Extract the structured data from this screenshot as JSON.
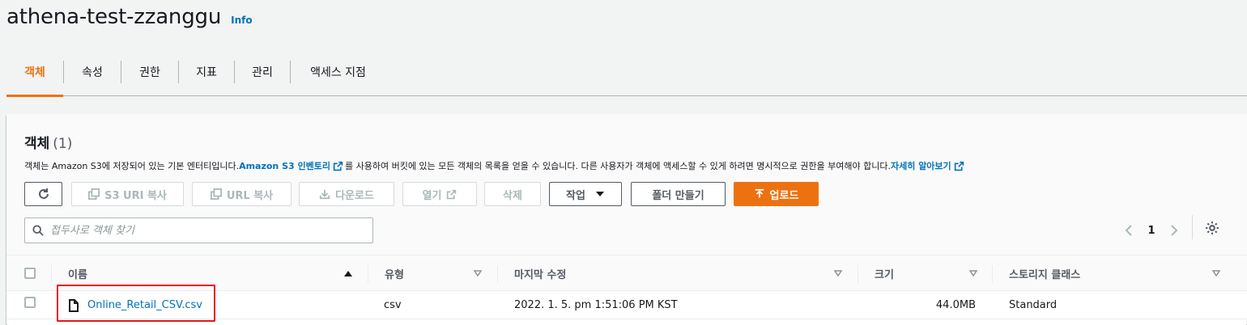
{
  "bucket": {
    "title": "athena-test-zzanggu",
    "info_label": "Info"
  },
  "tabs": [
    {
      "label": "객체",
      "active": true
    },
    {
      "label": "속성"
    },
    {
      "label": "권한"
    },
    {
      "label": "지표"
    },
    {
      "label": "관리"
    },
    {
      "label": "액세스 지점"
    }
  ],
  "objects": {
    "heading": "객체",
    "count": "(1)",
    "description": {
      "part1": "객체는 Amazon S3에 저장되어 있는 기본 엔터티입니다. ",
      "link1": "Amazon S3 인벤토리",
      "part2": "를 사용하여 버킷에 있는 모든 객체의 목록을 얻을 수 있습니다. 다른 사용자가 객체에 액세스할 수 있게 하려면 명시적으로 권한을 부여해야 합니다. ",
      "link2": "자세히 알아보기"
    },
    "toolbar": {
      "copy_s3_uri": "S3 URI 복사",
      "copy_url": "URL 복사",
      "download": "다운로드",
      "open": "열기",
      "delete": "삭제",
      "actions": "작업",
      "create_folder": "폴더 만들기",
      "upload": "업로드"
    },
    "search": {
      "placeholder": "접두사로 객체 찾기",
      "value": ""
    },
    "pagination": {
      "current_page": "1"
    },
    "table": {
      "columns": [
        "이름",
        "유형",
        "마지막 수정",
        "크기",
        "스토리지 클래스"
      ],
      "rows": [
        {
          "name": "Online_Retail_CSV.csv",
          "type": "csv",
          "last_modified": "2022. 1. 5. pm 1:51:06 PM KST",
          "size": "44.0MB",
          "storage_class": "Standard"
        }
      ]
    }
  },
  "colors": {
    "accent": "#ec7211",
    "link": "#0073bb",
    "highlight": "#e8151c"
  }
}
